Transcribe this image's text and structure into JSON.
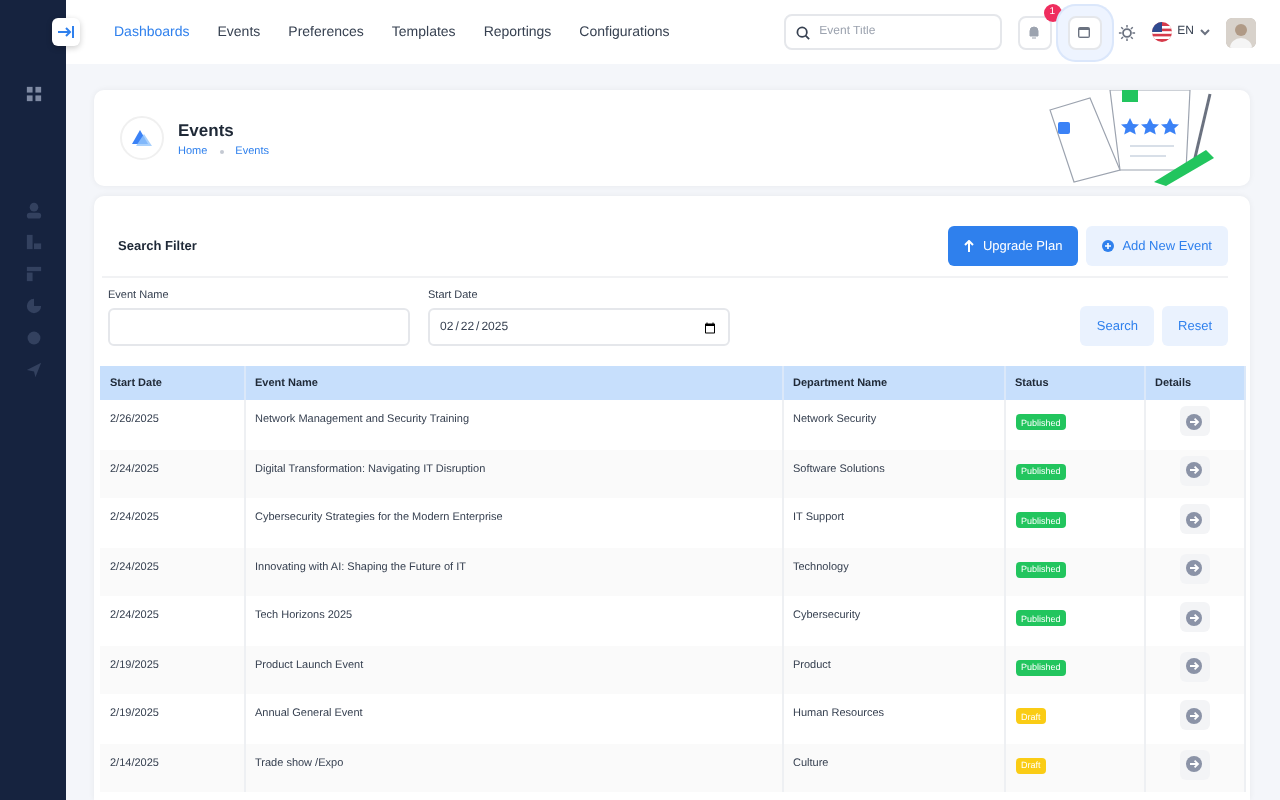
{
  "nav": [
    {
      "label": "Dashboards",
      "selected": true
    },
    {
      "label": "Events",
      "selected": false
    },
    {
      "label": "Preferences",
      "selected": false
    },
    {
      "label": "Templates",
      "selected": false
    },
    {
      "label": "Reportings",
      "selected": false
    },
    {
      "label": "Configurations",
      "selected": false
    }
  ],
  "search": {
    "placeholder": "Event Title"
  },
  "notifications": {
    "badge": "1"
  },
  "language": "EN",
  "page_header": {
    "title": "Events",
    "breadcrumb": [
      "Home",
      "Events"
    ]
  },
  "filter": {
    "title": "Search Filter",
    "upgrade_button": "Upgrade Plan",
    "add_button": "Add New Event",
    "fields": [
      {
        "label": "Event Name"
      },
      {
        "label": "Start Date",
        "value": "02/22/2025"
      }
    ],
    "search_button": "Search",
    "reset_button": "Reset"
  },
  "table": {
    "columns": [
      "Start Date",
      "Event Name",
      "Department Name",
      "Status",
      "Details"
    ],
    "rows": [
      {
        "date": "2/26/2025",
        "name": "Network Management and Security Training",
        "department": "Network Security",
        "status": "Published",
        "kind": "published"
      },
      {
        "date": "2/24/2025",
        "name": "Digital Transformation: Navigating IT Disruption",
        "department": "Software Solutions",
        "status": "Published",
        "kind": "published"
      },
      {
        "date": "2/24/2025",
        "name": "Cybersecurity Strategies for the Modern Enterprise",
        "department": "IT Support",
        "status": "Published",
        "kind": "published"
      },
      {
        "date": "2/24/2025",
        "name": "Innovating with AI: Shaping the Future of IT",
        "department": "Technology",
        "status": "Published",
        "kind": "published"
      },
      {
        "date": "2/24/2025",
        "name": "Tech Horizons 2025",
        "department": "Cybersecurity",
        "status": "Published",
        "kind": "published"
      },
      {
        "date": "2/19/2025",
        "name": "Product Launch Event",
        "department": "Product",
        "status": "Published",
        "kind": "published"
      },
      {
        "date": "2/19/2025",
        "name": "Annual General Event",
        "department": "Human Resources",
        "status": "Draft",
        "kind": "draft"
      },
      {
        "date": "2/14/2025",
        "name": "Trade show /Expo",
        "department": "Culture",
        "status": "Draft",
        "kind": "draft"
      }
    ]
  }
}
